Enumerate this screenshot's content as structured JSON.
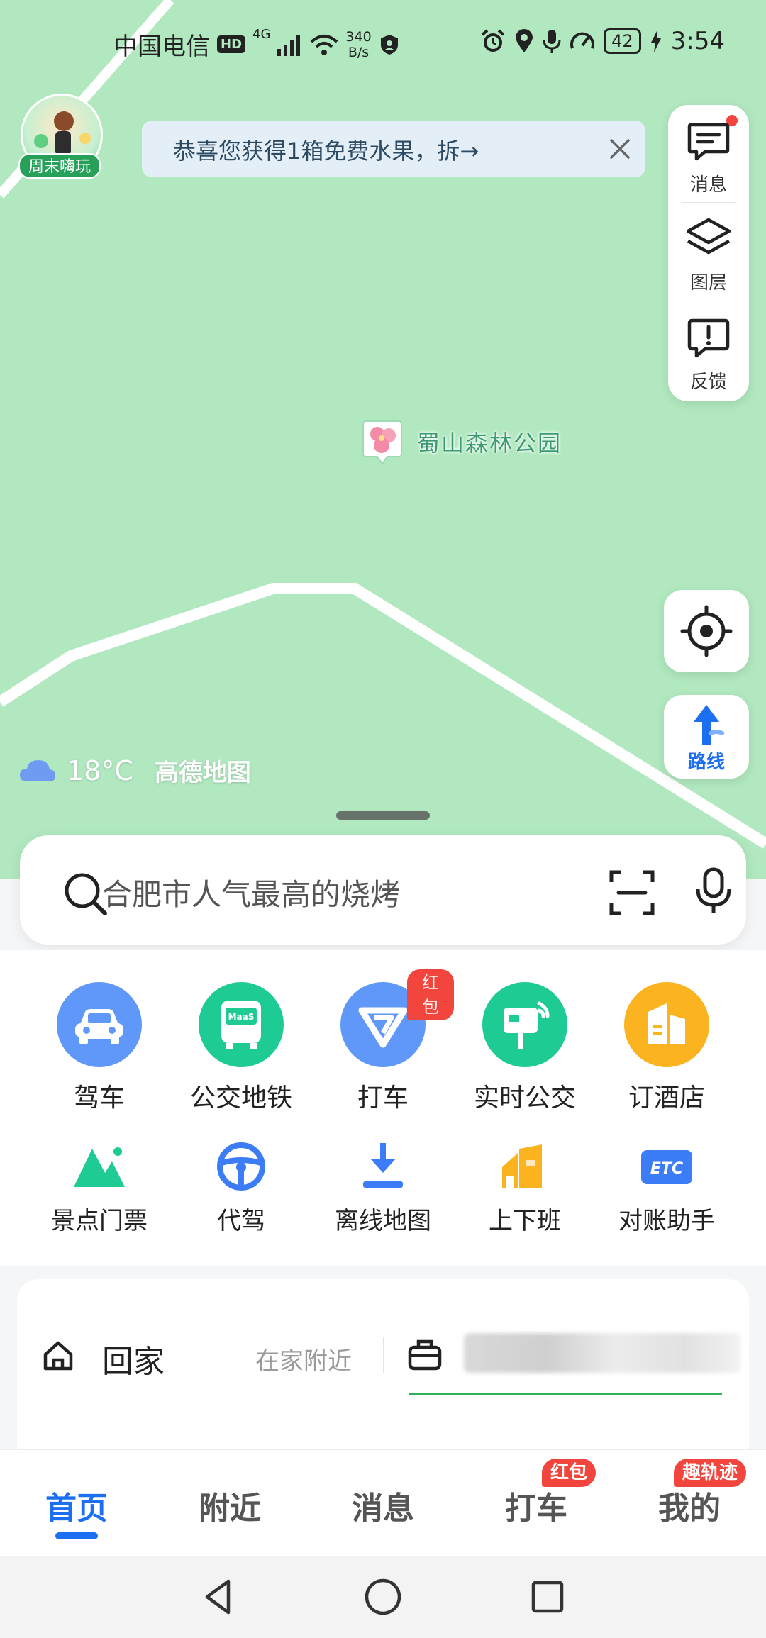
{
  "status_bar": {
    "carrier": "中国电信",
    "hd": "HD",
    "network": "4G",
    "net_speed_value": "340",
    "net_speed_unit": "B/s",
    "battery": "42",
    "time": "3:54"
  },
  "map": {
    "weekend_tag": "周末嗨玩",
    "promo_text": "恭喜您获得1箱免费水果，拆→",
    "side_panel": [
      {
        "label": "消息",
        "icon": "message-icon"
      },
      {
        "label": "图层",
        "icon": "layers-icon"
      },
      {
        "label": "反馈",
        "icon": "feedback-icon"
      }
    ],
    "poi_name": "蜀山森林公园",
    "route_label": "路线",
    "weather_temp": "18°C",
    "brand": "高德地图",
    "colors": {
      "map_bg": "#b1e8bf",
      "accent": "#1d6ff2"
    }
  },
  "search": {
    "placeholder": "合肥市人气最高的烧烤"
  },
  "features_row1": [
    {
      "label": "驾车",
      "icon": "car-icon",
      "color": "#5f98f8"
    },
    {
      "label": "公交地铁",
      "icon": "bus-icon",
      "color": "#1fcb95",
      "icon_text": "MaaS"
    },
    {
      "label": "打车",
      "icon": "taxi-icon",
      "color": "#5f98f8",
      "badge": "红包"
    },
    {
      "label": "实时公交",
      "icon": "bus-stop-icon",
      "color": "#1fcb95"
    },
    {
      "label": "订酒店",
      "icon": "hotel-icon",
      "color": "#fbb320"
    }
  ],
  "features_row2": [
    {
      "label": "景点门票",
      "icon": "mountain-icon"
    },
    {
      "label": "代驾",
      "icon": "steering-wheel-icon"
    },
    {
      "label": "离线地图",
      "icon": "download-icon"
    },
    {
      "label": "上下班",
      "icon": "building-icon"
    },
    {
      "label": "对账助手",
      "icon": "etc-icon",
      "icon_text": "ETC"
    }
  ],
  "shortcuts": {
    "home_label": "回家",
    "home_sub": "在家附近"
  },
  "tabs": [
    {
      "label": "首页",
      "active": true
    },
    {
      "label": "附近"
    },
    {
      "label": "消息"
    },
    {
      "label": "打车",
      "badge": "红包"
    },
    {
      "label": "我的",
      "badge": "趣轨迹"
    }
  ]
}
